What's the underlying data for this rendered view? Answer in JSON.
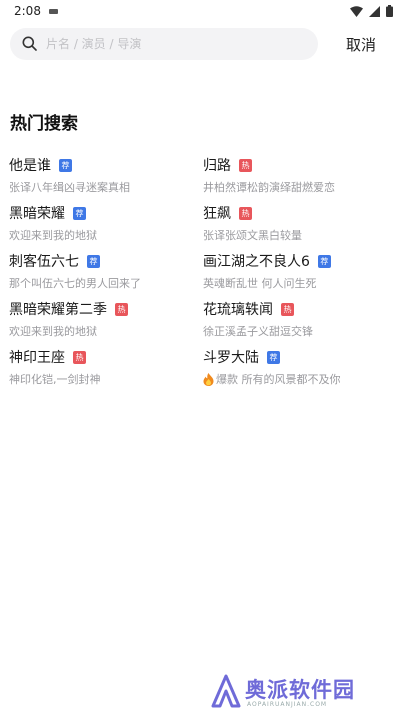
{
  "status": {
    "time": "2:08"
  },
  "search": {
    "placeholder": "片名 / 演员 / 导演",
    "value": "",
    "cancel_label": "取消"
  },
  "section": {
    "title": "热门搜索"
  },
  "hot_items": [
    {
      "title": "他是谁",
      "badge": "荐",
      "badge_type": "rec",
      "desc": "张译八年缉凶寻迷案真相"
    },
    {
      "title": "归路",
      "badge": "热",
      "badge_type": "hot",
      "desc": "井柏然谭松韵演绎甜燃爱恋"
    },
    {
      "title": "黑暗荣耀",
      "badge": "荐",
      "badge_type": "rec",
      "desc": "欢迎来到我的地狱"
    },
    {
      "title": "狂飙",
      "badge": "热",
      "badge_type": "hot",
      "desc": "张译张颂文黑白较量"
    },
    {
      "title": "刺客伍六七",
      "badge": "荐",
      "badge_type": "rec",
      "desc": "那个叫伍六七的男人回来了"
    },
    {
      "title": "画江湖之不良人6",
      "badge": "荐",
      "badge_type": "rec",
      "desc": "英魂断乱世 何人问生死"
    },
    {
      "title": "黑暗荣耀第二季",
      "badge": "热",
      "badge_type": "hot",
      "desc": "欢迎来到我的地狱"
    },
    {
      "title": "花琉璃轶闻",
      "badge": "热",
      "badge_type": "hot",
      "desc": "徐正溪孟子义甜逗交锋"
    },
    {
      "title": "神印王座",
      "badge": "热",
      "badge_type": "hot",
      "desc": "神印化铠,一剑封神"
    },
    {
      "title": "斗罗大陆",
      "badge": "荐",
      "badge_type": "rec",
      "desc": "爆款 所有的风景都不及你",
      "icon": "fire-icon"
    }
  ],
  "watermark": {
    "text": "奥派软件园",
    "sub": "AOPAIRUANJIAN.COM"
  },
  "colors": {
    "rec_badge": "#3f78e6",
    "hot_badge": "#e8565b",
    "search_bg": "#f3f3f5",
    "watermark": "#6f6bd8"
  }
}
